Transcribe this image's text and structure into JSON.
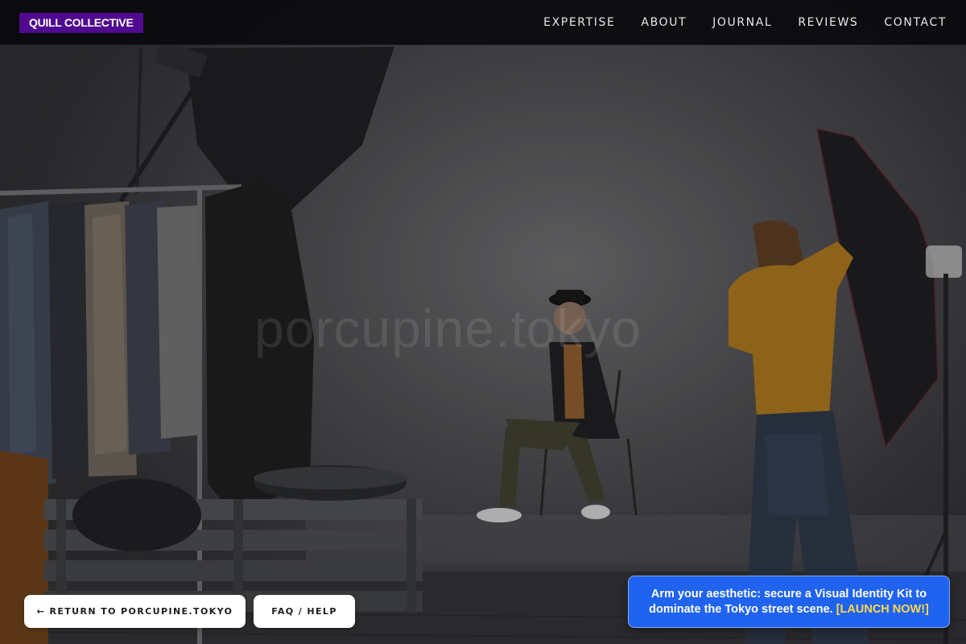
{
  "header": {
    "brand": "QUILL COLLECTIVE",
    "nav": [
      {
        "label": "EXPERTISE"
      },
      {
        "label": "ABOUT"
      },
      {
        "label": "JOURNAL"
      },
      {
        "label": "REVIEWS"
      },
      {
        "label": "CONTACT"
      }
    ]
  },
  "hero": {
    "watermark": "porcupine.tokyo"
  },
  "actions": {
    "return_label": "← RETURN TO PORCUPINE.TOKYO",
    "faq_label": "FAQ / HELP"
  },
  "promo": {
    "text": "Arm your aesthetic: secure a Visual Identity Kit to dominate the Tokyo street scene. ",
    "cta": "[LAUNCH NOW!]"
  },
  "colors": {
    "brand_bg": "#4f0a8f",
    "promo_bg": "#1f63ef",
    "promo_cta": "#ffd84a",
    "header_bg": "#08080a"
  }
}
